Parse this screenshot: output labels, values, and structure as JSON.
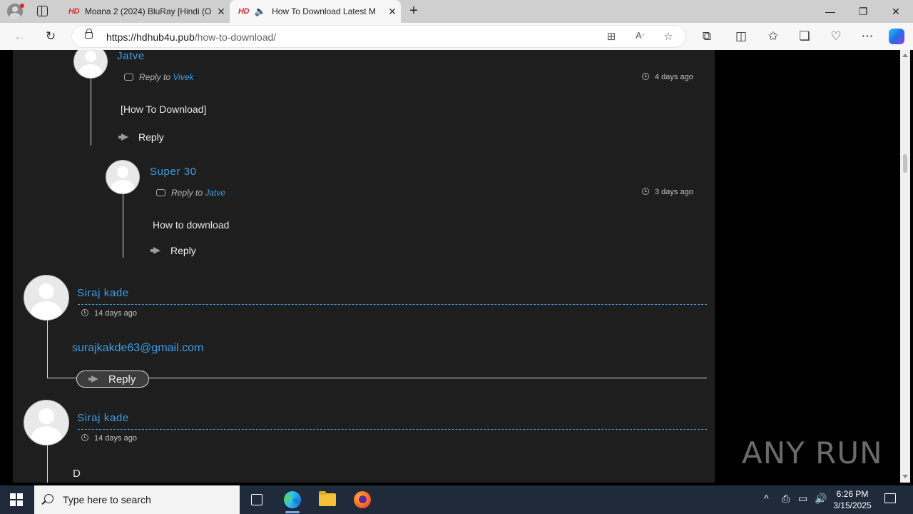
{
  "browser": {
    "tabs": [
      {
        "favicon": "HD",
        "title": "Moana 2 (2024) BluRay [Hindi (O"
      },
      {
        "favicon": "HD",
        "title": "How To Download Latest M"
      }
    ],
    "url_host": "https://hdhub4u.pub",
    "url_path": "/how-to-download/"
  },
  "comments": [
    {
      "author": "Jatve",
      "reply_prefix": "Reply to",
      "reply_to": "Vivek",
      "time": "4 days ago",
      "text": "[How To Download]",
      "reply_label": "Reply"
    },
    {
      "author": "Super 30",
      "reply_prefix": "Reply to",
      "reply_to": "Jatve",
      "time": "3 days ago",
      "text": "How to download",
      "reply_label": "Reply"
    },
    {
      "author": "Siraj kade",
      "time": "14 days ago",
      "text": "surajkakde63@gmail.com",
      "reply_label": "Reply"
    },
    {
      "author": "Siraj kade",
      "time": "14 days ago",
      "text": "D"
    }
  ],
  "watermark": "ANY RUN",
  "taskbar": {
    "search_placeholder": "Type here to search",
    "time": "6:26 PM",
    "date": "3/15/2025"
  },
  "colors": {
    "link": "#3a9fe6",
    "page_bg": "#1e1e1e",
    "taskbar": "#1f2a3a"
  }
}
